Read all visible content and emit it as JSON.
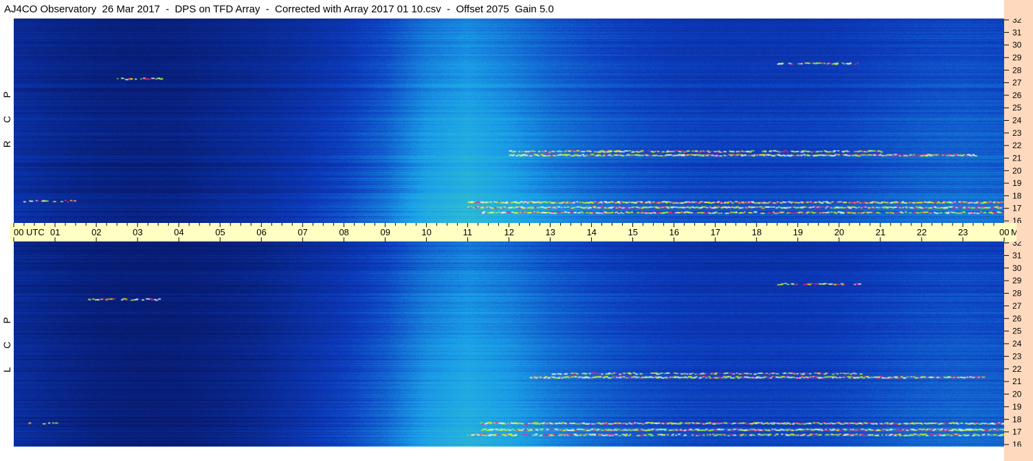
{
  "header": {
    "title": "AJ4CO Observatory  26 Mar 2017  -  DPS on TFD Array  -  Corrected with Array 2017 01 10.csv  -  Offset 2075  Gain 5.0"
  },
  "panels": {
    "top": {
      "polarization_letters": [
        "R",
        "C",
        "P"
      ]
    },
    "bottom": {
      "polarization_letters": [
        "L",
        "C",
        "P"
      ]
    }
  },
  "axes": {
    "time_labels": [
      "00",
      "01",
      "02",
      "03",
      "04",
      "05",
      "06",
      "07",
      "08",
      "09",
      "10",
      "11",
      "12",
      "13",
      "14",
      "15",
      "16",
      "17",
      "18",
      "19",
      "20",
      "21",
      "22",
      "23",
      "00"
    ],
    "time_unit": "UTC",
    "freq_unit": "MHz",
    "freq_labels": [
      "32",
      "31",
      "30",
      "29",
      "28",
      "27",
      "26",
      "25",
      "24",
      "23",
      "22",
      "21",
      "20",
      "19",
      "18",
      "17",
      "16"
    ]
  },
  "colors": {
    "title_bg": "#ffffff",
    "axis_bg": "#ffffc3",
    "freq_axis_bg": "#fed9bd",
    "low_intensity": "#071a6e",
    "background_intensity": "#0c3bbe",
    "mid_intensity": "#1aa0e8",
    "high_intensity": "#46e0b8",
    "interference_colors": [
      "#ffff00",
      "#ff2080",
      "#ffffff",
      "#a0ff40"
    ]
  },
  "chart_data": {
    "type": "heatmap",
    "title": "AJ4CO Observatory  26 Mar 2017  -  DPS on TFD Array  -  Corrected with Array 2017 01 10.csv  -  Offset 2075  Gain 5.0",
    "x_range_utc_hours": [
      0,
      24
    ],
    "y_range_mhz": [
      16,
      32
    ],
    "panels": [
      {
        "name": "RCP",
        "brightness_by_hour": [
          {
            "hour": 0,
            "level": 0.18
          },
          {
            "hour": 1,
            "level": 0.12
          },
          {
            "hour": 2,
            "level": 0.08
          },
          {
            "hour": 3,
            "level": 0.06
          },
          {
            "hour": 4,
            "level": 0.07
          },
          {
            "hour": 5,
            "level": 0.12
          },
          {
            "hour": 6,
            "level": 0.16
          },
          {
            "hour": 7,
            "level": 0.22
          },
          {
            "hour": 8,
            "level": 0.3
          },
          {
            "hour": 9,
            "level": 0.42
          },
          {
            "hour": 10,
            "level": 0.62
          },
          {
            "hour": 11,
            "level": 0.72
          },
          {
            "hour": 12,
            "level": 0.62
          },
          {
            "hour": 13,
            "level": 0.5
          },
          {
            "hour": 14,
            "level": 0.42
          },
          {
            "hour": 15,
            "level": 0.36
          },
          {
            "hour": 16,
            "level": 0.32
          },
          {
            "hour": 17,
            "level": 0.3
          },
          {
            "hour": 18,
            "level": 0.3
          },
          {
            "hour": 19,
            "level": 0.3
          },
          {
            "hour": 20,
            "level": 0.32
          },
          {
            "hour": 21,
            "level": 0.36
          },
          {
            "hour": 22,
            "level": 0.4
          },
          {
            "hour": 23,
            "level": 0.42
          },
          {
            "hour": 24,
            "level": 0.4
          }
        ],
        "interference_bands": [
          {
            "mhz": 17.2,
            "start_hour": 11.0,
            "end_hour": 24.0,
            "strength": 0.95
          },
          {
            "mhz": 17.6,
            "start_hour": 11.0,
            "end_hour": 24.0,
            "strength": 0.9
          },
          {
            "mhz": 16.8,
            "start_hour": 11.2,
            "end_hour": 24.0,
            "strength": 0.7
          },
          {
            "mhz": 21.3,
            "start_hour": 12.0,
            "end_hour": 23.3,
            "strength": 0.95
          },
          {
            "mhz": 21.6,
            "start_hour": 12.0,
            "end_hour": 21.0,
            "strength": 0.7
          },
          {
            "mhz": 28.5,
            "start_hour": 18.5,
            "end_hour": 20.5,
            "strength": 0.6
          },
          {
            "mhz": 27.3,
            "start_hour": 2.5,
            "end_hour": 3.6,
            "strength": 0.5
          },
          {
            "mhz": 17.7,
            "start_hour": 0.2,
            "end_hour": 1.5,
            "strength": 0.5
          }
        ]
      },
      {
        "name": "LCP",
        "brightness_by_hour": [
          {
            "hour": 0,
            "level": 0.16
          },
          {
            "hour": 1,
            "level": 0.1
          },
          {
            "hour": 2,
            "level": 0.05
          },
          {
            "hour": 3,
            "level": 0.03
          },
          {
            "hour": 4,
            "level": 0.03
          },
          {
            "hour": 5,
            "level": 0.07
          },
          {
            "hour": 6,
            "level": 0.12
          },
          {
            "hour": 7,
            "level": 0.2
          },
          {
            "hour": 8,
            "level": 0.28
          },
          {
            "hour": 9,
            "level": 0.4
          },
          {
            "hour": 10,
            "level": 0.58
          },
          {
            "hour": 11,
            "level": 0.68
          },
          {
            "hour": 12,
            "level": 0.6
          },
          {
            "hour": 13,
            "level": 0.48
          },
          {
            "hour": 14,
            "level": 0.4
          },
          {
            "hour": 15,
            "level": 0.34
          },
          {
            "hour": 16,
            "level": 0.3
          },
          {
            "hour": 17,
            "level": 0.28
          },
          {
            "hour": 18,
            "level": 0.28
          },
          {
            "hour": 19,
            "level": 0.28
          },
          {
            "hour": 20,
            "level": 0.3
          },
          {
            "hour": 21,
            "level": 0.34
          },
          {
            "hour": 22,
            "level": 0.38
          },
          {
            "hour": 23,
            "level": 0.4
          },
          {
            "hour": 24,
            "level": 0.38
          }
        ],
        "interference_bands": [
          {
            "mhz": 17.3,
            "start_hour": 11.3,
            "end_hour": 24.0,
            "strength": 0.95
          },
          {
            "mhz": 17.8,
            "start_hour": 11.3,
            "end_hour": 24.0,
            "strength": 0.9
          },
          {
            "mhz": 16.9,
            "start_hour": 11.0,
            "end_hour": 24.0,
            "strength": 0.7
          },
          {
            "mhz": 21.4,
            "start_hour": 12.5,
            "end_hour": 23.5,
            "strength": 0.95
          },
          {
            "mhz": 21.7,
            "start_hour": 13.0,
            "end_hour": 20.5,
            "strength": 0.6
          },
          {
            "mhz": 28.7,
            "start_hour": 18.5,
            "end_hour": 20.5,
            "strength": 0.55
          },
          {
            "mhz": 27.5,
            "start_hour": 1.8,
            "end_hour": 3.6,
            "strength": 0.5
          },
          {
            "mhz": 17.8,
            "start_hour": 0.3,
            "end_hour": 1.0,
            "strength": 0.4
          }
        ]
      }
    ]
  }
}
